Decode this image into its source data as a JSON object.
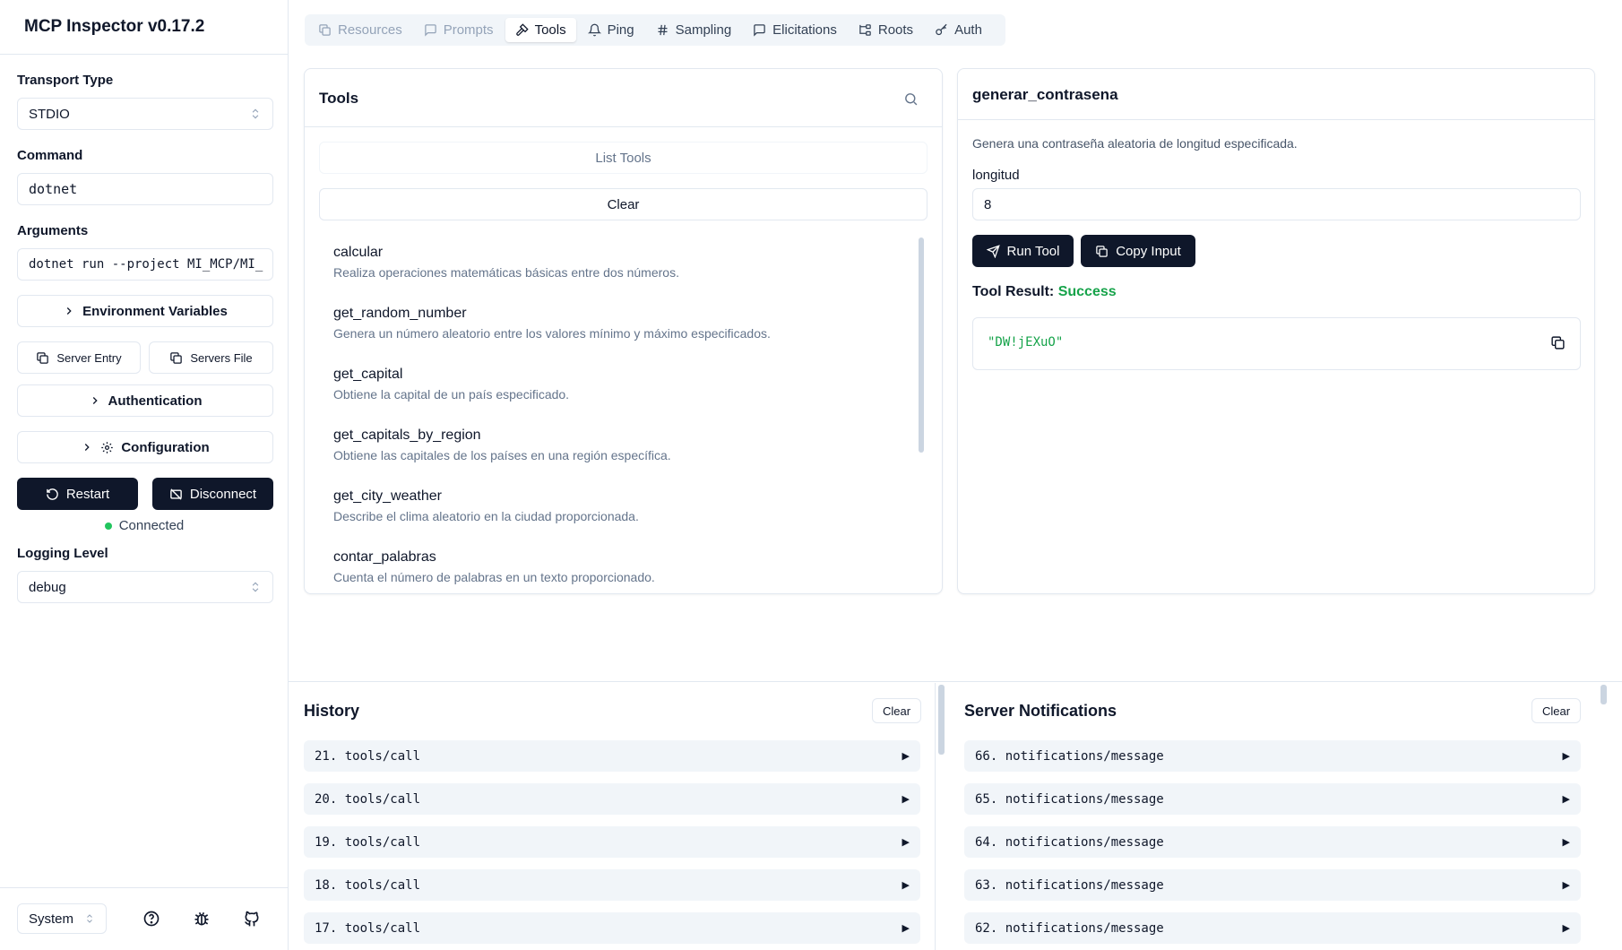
{
  "app": {
    "title": "MCP Inspector v0.17.2"
  },
  "sidebar": {
    "transport_label": "Transport Type",
    "transport_value": "STDIO",
    "command_label": "Command",
    "command_value": "dotnet",
    "arguments_label": "Arguments",
    "arguments_value": "dotnet run --project MI_MCP/MI_",
    "env_vars": "Environment Variables",
    "server_entry": "Server Entry",
    "servers_file": "Servers File",
    "authentication": "Authentication",
    "configuration": "Configuration",
    "restart": "Restart",
    "disconnect": "Disconnect",
    "status": "Connected",
    "logging_label": "Logging Level",
    "logging_value": "debug",
    "theme_value": "System"
  },
  "tabs": [
    {
      "label": "Resources",
      "icon": "files-icon",
      "state": "disabled"
    },
    {
      "label": "Prompts",
      "icon": "message-square-icon",
      "state": "disabled"
    },
    {
      "label": "Tools",
      "icon": "hammer-icon",
      "state": "active"
    },
    {
      "label": "Ping",
      "icon": "bell-icon",
      "state": "normal"
    },
    {
      "label": "Sampling",
      "icon": "hash-icon",
      "state": "normal"
    },
    {
      "label": "Elicitations",
      "icon": "message-square-icon",
      "state": "normal"
    },
    {
      "label": "Roots",
      "icon": "folder-tree-icon",
      "state": "normal"
    },
    {
      "label": "Auth",
      "icon": "key-icon",
      "state": "normal"
    }
  ],
  "tools_panel": {
    "title": "Tools",
    "list_tools": "List Tools",
    "clear": "Clear",
    "items": [
      {
        "name": "calcular",
        "description": "Realiza operaciones matemáticas básicas entre dos números."
      },
      {
        "name": "get_random_number",
        "description": "Genera un número aleatorio entre los valores mínimo y máximo especificados."
      },
      {
        "name": "get_capital",
        "description": "Obtiene la capital de un país especificado."
      },
      {
        "name": "get_capitals_by_region",
        "description": "Obtiene las capitales de los países en una región específica."
      },
      {
        "name": "get_city_weather",
        "description": "Describe el clima aleatorio en la ciudad proporcionada."
      },
      {
        "name": "contar_palabras",
        "description": "Cuenta el número de palabras en un texto proporcionado."
      }
    ]
  },
  "tool_detail": {
    "name": "generar_contrasena",
    "description": "Genera una contraseña aleatoria de longitud especificada.",
    "param_label": "longitud",
    "param_value": "8",
    "run_tool": "Run Tool",
    "copy_input": "Copy Input",
    "result_label": "Tool Result:",
    "result_status": "Success",
    "result_value": "\"DW!jEXuO\""
  },
  "history": {
    "title": "History",
    "clear": "Clear",
    "items": [
      "21. tools/call",
      "20. tools/call",
      "19. tools/call",
      "18. tools/call",
      "17. tools/call"
    ]
  },
  "notifications": {
    "title": "Server Notifications",
    "clear": "Clear",
    "items": [
      "66. notifications/message",
      "65. notifications/message",
      "64. notifications/message",
      "63. notifications/message",
      "62. notifications/message"
    ]
  },
  "colors": {
    "primary": "#0f172a",
    "success": "#16a34a",
    "status_dot": "#22c55e",
    "muted": "#64748b",
    "json_string": "#16a34a"
  }
}
